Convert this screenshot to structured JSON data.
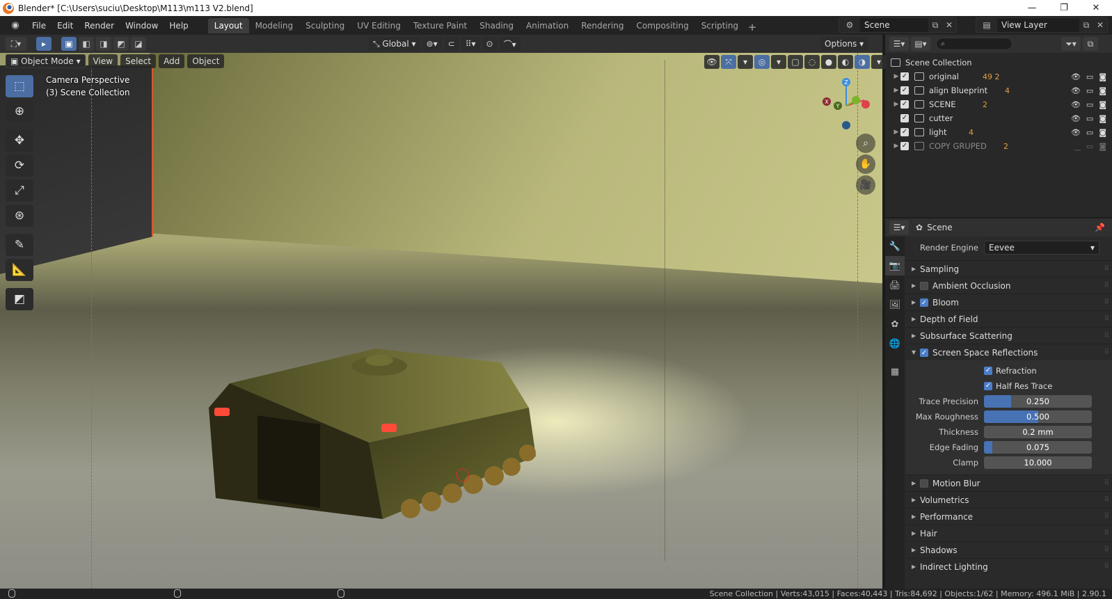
{
  "window": {
    "title": "Blender* [C:\\Users\\suciu\\Desktop\\M113\\m113 V2.blend]"
  },
  "menu": [
    "File",
    "Edit",
    "Render",
    "Window",
    "Help"
  ],
  "workspaces": {
    "tabs": [
      "Layout",
      "Modeling",
      "Sculpting",
      "UV Editing",
      "Texture Paint",
      "Shading",
      "Animation",
      "Rendering",
      "Compositing",
      "Scripting"
    ],
    "active": "Layout"
  },
  "scene_selector": "Scene",
  "view_layer_selector": "View Layer",
  "viewport": {
    "transform_orientation": "Global",
    "options_label": "Options",
    "mode": "Object Mode",
    "menus": [
      "View",
      "Select",
      "Add",
      "Object"
    ],
    "camera_label": "Camera Perspective",
    "collection_label": "(3) Scene Collection"
  },
  "outliner": {
    "root": "Scene Collection",
    "items": [
      {
        "name": "original",
        "badges": "49  2",
        "dim": false
      },
      {
        "name": "align Blueprint",
        "badges": "4",
        "dim": false
      },
      {
        "name": "SCENE",
        "badges": "2",
        "dim": false
      },
      {
        "name": "cutter",
        "badges": "",
        "dim": false
      },
      {
        "name": "light",
        "badges": "4",
        "dim": false
      },
      {
        "name": "COPY GRUPED",
        "badges": "2",
        "dim": true
      }
    ]
  },
  "properties": {
    "context": "Scene",
    "render_engine_label": "Render Engine",
    "render_engine": "Eevee",
    "panels_top": [
      {
        "label": "Sampling",
        "checkbox": null
      },
      {
        "label": "Ambient Occlusion",
        "checkbox": false
      },
      {
        "label": "Bloom",
        "checkbox": true
      },
      {
        "label": "Depth of Field",
        "checkbox": null
      },
      {
        "label": "Subsurface Scattering",
        "checkbox": null
      }
    ],
    "ssr": {
      "label": "Screen Space Reflections",
      "enabled": true,
      "refraction_label": "Refraction",
      "half_res_label": "Half Res Trace",
      "fields": [
        {
          "label": "Trace Precision",
          "value": "0.250",
          "fraction": 0.25
        },
        {
          "label": "Max Roughness",
          "value": "0.500",
          "fraction": 0.5
        },
        {
          "label": "Thickness",
          "value": "0.2 mm",
          "fraction": 0
        },
        {
          "label": "Edge Fading",
          "value": "0.075",
          "fraction": 0.075
        },
        {
          "label": "Clamp",
          "value": "10.000",
          "fraction": 0
        }
      ]
    },
    "panels_bottom": [
      {
        "label": "Motion Blur",
        "checkbox": false
      },
      {
        "label": "Volumetrics",
        "checkbox": null
      },
      {
        "label": "Performance",
        "checkbox": null
      },
      {
        "label": "Hair",
        "checkbox": null
      },
      {
        "label": "Shadows",
        "checkbox": null
      },
      {
        "label": "Indirect Lighting",
        "checkbox": null
      }
    ]
  },
  "statusbar": {
    "stats": "Scene Collection | Verts:43,015 | Faces:40,443 | Tris:84,692 | Objects:1/62 | Memory: 496.1 MiB | 2.90.1"
  },
  "colors": {
    "accent": "#4772b3",
    "selection_outline": "#d75a2a"
  }
}
